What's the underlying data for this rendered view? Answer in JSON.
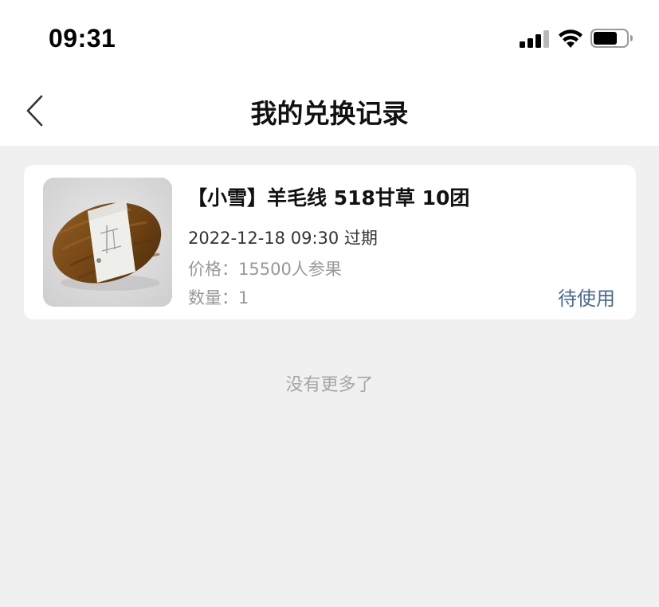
{
  "status_bar": {
    "time": "09:31"
  },
  "nav": {
    "title": "我的兑换记录"
  },
  "records": [
    {
      "title": "【小雪】羊毛线 518甘草 10团",
      "date": "2022-12-18 09:30 过期",
      "price_label": "价格：",
      "price_value": "15500人参果",
      "qty_label": "数量：",
      "qty_value": "1",
      "status": "待使用"
    }
  ],
  "footer": {
    "no_more": "没有更多了"
  },
  "colors": {
    "background": "#f0f0f0",
    "card": "#ffffff",
    "status_accent": "#4c6a93",
    "muted_text": "#999999",
    "yarn_brown": "#7a4a17"
  },
  "icons": {
    "back": "chevron-left-icon",
    "signal": "cellular-signal-icon",
    "wifi": "wifi-icon",
    "battery": "battery-icon"
  }
}
